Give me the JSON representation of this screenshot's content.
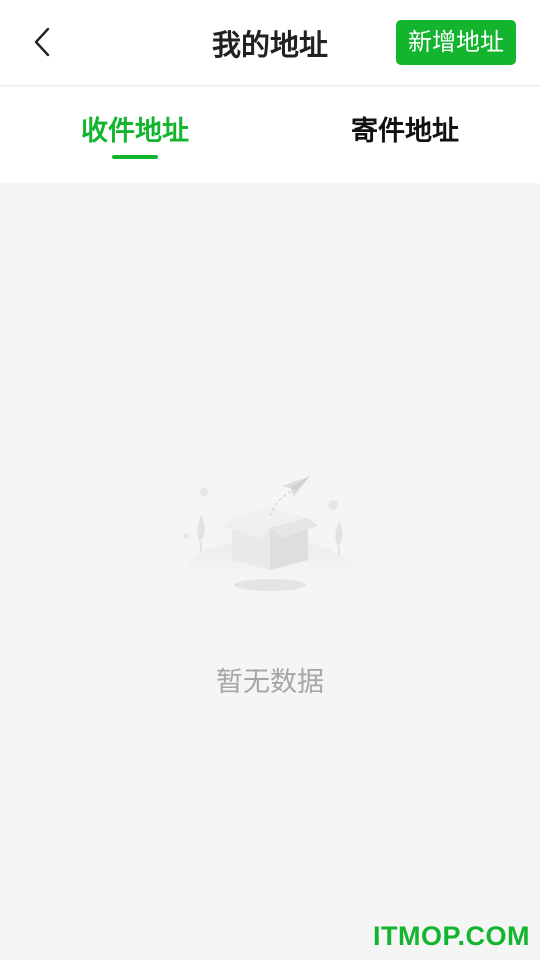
{
  "header": {
    "title": "我的地址",
    "back_icon": "chevron-left-icon",
    "add_button_label": "新增地址"
  },
  "tabs": [
    {
      "label": "收件地址",
      "active": true
    },
    {
      "label": "寄件地址",
      "active": false
    }
  ],
  "empty_state": {
    "icon": "empty-box-icon",
    "message": "暂无数据"
  },
  "watermark": "ITMOP.COM",
  "colors": {
    "accent": "#13b52f",
    "background": "#f5f5f5",
    "muted_text": "#a6a6a6"
  }
}
